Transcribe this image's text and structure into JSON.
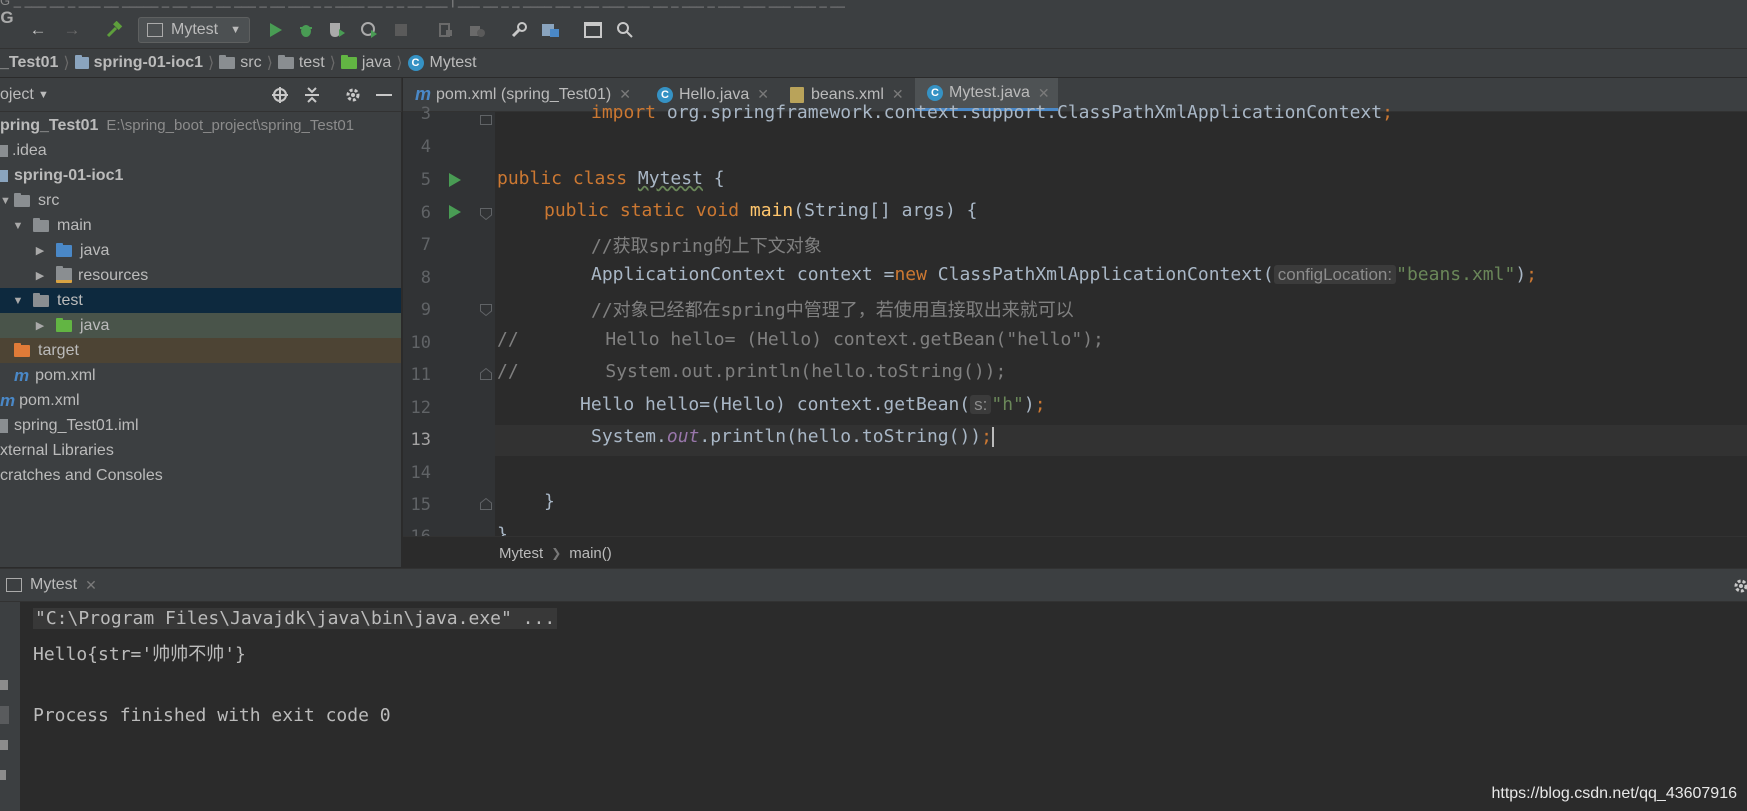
{
  "top_strip": {
    "text": "G _ ___ __ _ ___ __ _____ _ __ ___ __ ___ _ __ ___ _ _ ____ __ _ _ __ ___ | ___ __ _ _ ____ __ _ __ ___ ___ __ _ ___ _ ___ ___ ___ ___ _ __"
  },
  "toolbar": {
    "run_config_label": "Mytest",
    "icons": [
      "back-arrow-icon",
      "forward-arrow-icon",
      "hammer-icon",
      "run-icon",
      "debug-icon",
      "coverage-icon",
      "profile-icon",
      "stop-icon",
      "build-icon",
      "wrench-icon",
      "structure-icon",
      "terminal-icon",
      "search-icon"
    ]
  },
  "breadcrumb": {
    "items": [
      "_Test01",
      "spring-01-ioc1",
      "src",
      "test",
      "java",
      "Mytest"
    ]
  },
  "project_panel": {
    "title": "oject",
    "tree": [
      {
        "label": "pring_Test01",
        "path": "E:\\spring_boot_project\\spring_Test01",
        "icon": "module",
        "bold": true
      },
      {
        "label": ".idea",
        "icon": "folder-gray"
      },
      {
        "label": "spring-01-ioc1",
        "icon": "module",
        "bold": true
      },
      {
        "label": "src",
        "icon": "folder-gray"
      },
      {
        "label": "main",
        "icon": "folder-gray"
      },
      {
        "label": "java",
        "icon": "folder-blue"
      },
      {
        "label": "resources",
        "icon": "folder-resources"
      },
      {
        "label": "test",
        "icon": "folder-gray",
        "selected": true
      },
      {
        "label": "java",
        "icon": "folder-green"
      },
      {
        "label": "target",
        "icon": "folder-orange"
      },
      {
        "label": "pom.xml",
        "icon": "maven"
      },
      {
        "label": "pom.xml",
        "icon": "maven"
      },
      {
        "label": "spring_Test01.iml",
        "icon": "iml"
      },
      {
        "label": "xternal Libraries",
        "icon": "none"
      },
      {
        "label": "cratches and Consoles",
        "icon": "none"
      }
    ]
  },
  "tabs": [
    {
      "label": "pom.xml (spring_Test01)",
      "icon": "maven-icon"
    },
    {
      "label": "Hello.java",
      "icon": "class-icon"
    },
    {
      "label": "beans.xml",
      "icon": "xml-icon"
    },
    {
      "label": "Mytest.java",
      "icon": "class-icon",
      "active": true
    }
  ],
  "editor": {
    "line_numbers": [
      "3",
      "4",
      "5",
      "6",
      "7",
      "8",
      "9",
      "10",
      "11",
      "12",
      "13",
      "14",
      "15",
      "16"
    ],
    "line3": {
      "kw": "import",
      "rest": " org.springframework.context.support.ClassPathXmlApplicationContext",
      "semi": ";"
    },
    "line5": {
      "kw": "public class ",
      "name": "Mytest",
      "rest": " {"
    },
    "line6": {
      "kw": "public static void ",
      "fn": "main",
      "rest": "(String[] args) {"
    },
    "line7": "//获取spring的上下文对象",
    "line8": {
      "a": "ApplicationContext context =",
      "kw": "new",
      "b": " ClassPathXmlApplicationContext(",
      "hint": "configLocation:",
      "str": "\"beans.xml\"",
      "c": ")",
      "semi": ";"
    },
    "line9": "//对象已经都在spring中管理了，若使用直接取出来就可以",
    "line10": "//        Hello hello= (Hello) context.getBean(\"hello\");",
    "line11": "//        System.out.println(hello.toString());",
    "line12": {
      "a": "Hello hello=(Hello) context.getBean(",
      "hint": "s:",
      "str": "\"h\"",
      "c": ")",
      "semi": ";"
    },
    "line13": {
      "a": "System.",
      "st": "out",
      "b": ".println(hello.toString())",
      "semi": ";"
    },
    "line15": "}",
    "line16": "}",
    "breadcrumb": [
      "Mytest",
      "main()"
    ]
  },
  "run_panel": {
    "tab_label": "Mytest",
    "lines": [
      "\"C:\\Program Files\\Javajdk\\java\\bin\\java.exe\" ...",
      "Hello{str='帅帅不帅'}",
      "",
      "Process finished with exit code 0"
    ]
  },
  "watermark": "https://blog.csdn.net/qq_43607916"
}
